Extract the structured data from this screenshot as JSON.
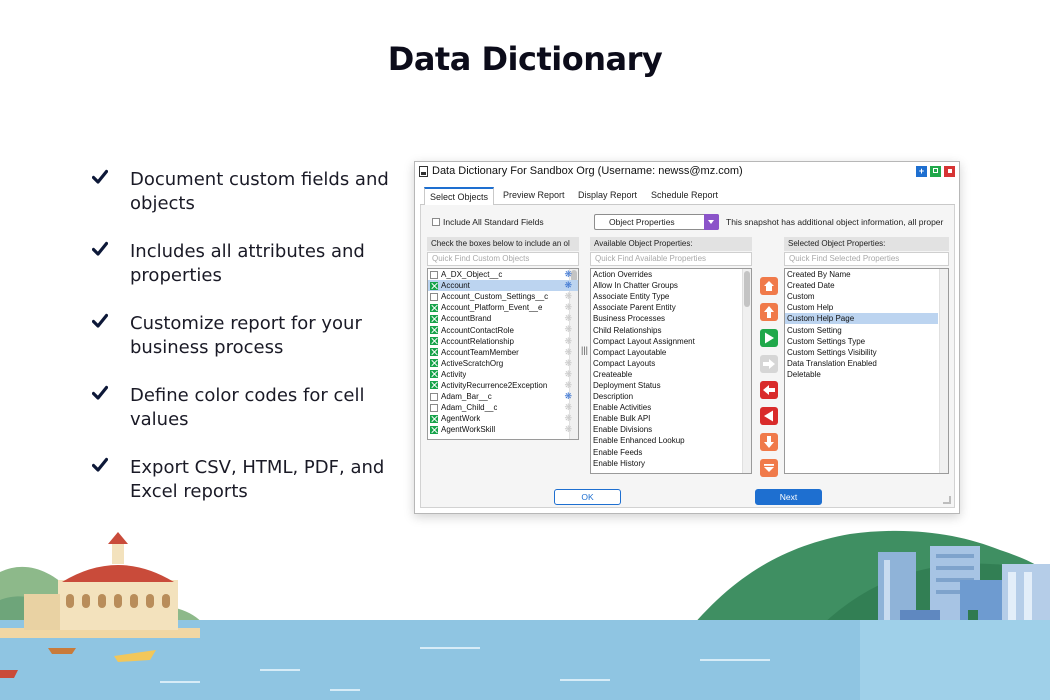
{
  "page": {
    "title": "Data Dictionary"
  },
  "features": [
    {
      "text": "Document custom fields and objects"
    },
    {
      "text": "Includes all attributes and properties"
    },
    {
      "text": "Customize report for your business process"
    },
    {
      "text": "Define color codes for cell values"
    },
    {
      "text": "Export CSV, HTML, PDF, and Excel reports"
    }
  ],
  "window": {
    "title": "Data Dictionary For Sandbox Org (Username: newss@mz.com)",
    "tabs": [
      "Select Objects",
      "Preview Report",
      "Display Report",
      "Schedule Report"
    ],
    "include_standard_label": "Include All Standard Fields",
    "dropdown_value": "Object Properties",
    "snapshot_note": "This snapshot has additional object information, all proper",
    "objects": {
      "header": "Check the boxes below to include an ol",
      "placeholder": "Quick Find Custom Objects",
      "items": [
        {
          "name": "A_DX_Object__c",
          "checked": false,
          "star": "blue"
        },
        {
          "name": "Account",
          "checked": true,
          "star": "blue",
          "selected": true
        },
        {
          "name": "Account_Custom_Settings__c",
          "checked": false,
          "star": "grey"
        },
        {
          "name": "Account_Platform_Event__e",
          "checked": true,
          "star": "grey"
        },
        {
          "name": "AccountBrand",
          "checked": true,
          "star": "grey"
        },
        {
          "name": "AccountContactRole",
          "checked": true,
          "star": "grey"
        },
        {
          "name": "AccountRelationship",
          "checked": true,
          "star": "grey"
        },
        {
          "name": "AccountTeamMember",
          "checked": true,
          "star": "grey"
        },
        {
          "name": "ActiveScratchOrg",
          "checked": true,
          "star": "grey"
        },
        {
          "name": "Activity",
          "checked": true,
          "star": "grey"
        },
        {
          "name": "ActivityRecurrence2Exception",
          "checked": true,
          "star": "grey"
        },
        {
          "name": "Adam_Bar__c",
          "checked": false,
          "star": "blue"
        },
        {
          "name": "Adam_Child__c",
          "checked": false,
          "star": "grey"
        },
        {
          "name": "AgentWork",
          "checked": true,
          "star": "grey"
        },
        {
          "name": "AgentWorkSkill",
          "checked": true,
          "star": "grey"
        }
      ]
    },
    "available": {
      "header": "Available Object Properties:",
      "placeholder": "Quick Find Available Properties",
      "items": [
        "Action Overrides",
        "Allow In Chatter Groups",
        "Associate Entity Type",
        "Associate Parent Entity",
        "Business Processes",
        "Child Relationships",
        "Compact Layout Assignment",
        "Compact Layoutable",
        "Compact Layouts",
        "Createable",
        "Deployment Status",
        "Description",
        "Enable Activities",
        "Enable Bulk API",
        "Enable Divisions",
        "Enable Enhanced Lookup",
        "Enable Feeds",
        "Enable History"
      ]
    },
    "selected": {
      "header": "Selected Object Properties:",
      "placeholder": "Quick Find Selected Properties",
      "items": [
        "Created By Name",
        "Created Date",
        "Custom",
        "Custom Help",
        "Custom Help Page",
        "Custom Setting",
        "Custom Settings Type",
        "Custom Settings Visibility",
        "Data Translation Enabled",
        "Deletable"
      ],
      "highlighted": "Custom Help Page"
    },
    "move_buttons": [
      {
        "icon": "move-top-icon",
        "color": "#f07a4a"
      },
      {
        "icon": "move-up-icon",
        "color": "#f07a4a"
      },
      {
        "icon": "add-right-icon",
        "color": "#1fa84a"
      },
      {
        "icon": "add-all-right-icon",
        "color": "#d6d6d6"
      },
      {
        "icon": "remove-left-icon",
        "color": "#d92b2b"
      },
      {
        "icon": "remove-all-left-icon",
        "color": "#d92b2b"
      },
      {
        "icon": "move-down-icon",
        "color": "#f07a4a"
      },
      {
        "icon": "move-bottom-icon",
        "color": "#f07a4a"
      }
    ],
    "ok_label": "OK",
    "next_label": "Next"
  },
  "colors": {
    "accent": "#1e6fd0",
    "check": "#16a34a",
    "dropdown": "#8b54c9",
    "title": "#0c0c1a"
  }
}
